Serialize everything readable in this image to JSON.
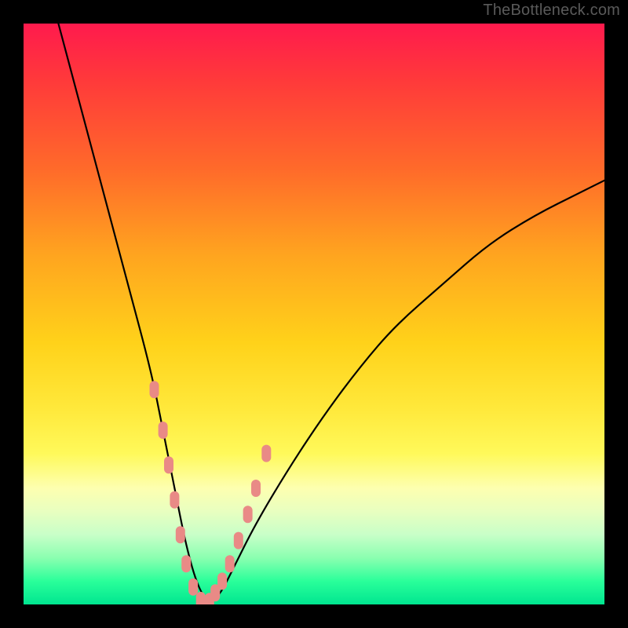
{
  "watermark": "TheBottleneck.com",
  "chart_data": {
    "type": "line",
    "title": "",
    "xlabel": "",
    "ylabel": "",
    "xlim": [
      0,
      100
    ],
    "ylim": [
      0,
      100
    ],
    "series": [
      {
        "name": "bottleneck-curve",
        "x": [
          6,
          10,
          14,
          18,
          22,
          24,
          26,
          28,
          30,
          32,
          34,
          36,
          40,
          46,
          52,
          58,
          64,
          72,
          80,
          88,
          96,
          100
        ],
        "values": [
          100,
          85,
          70,
          55,
          40,
          30,
          20,
          10,
          3,
          0,
          2,
          6,
          14,
          24,
          33,
          41,
          48,
          55,
          62,
          67,
          71,
          73
        ]
      }
    ],
    "markers": {
      "name": "highlighted-range",
      "color": "#e98a86",
      "points_x": [
        22.5,
        24,
        25,
        26,
        27,
        28,
        29.2,
        30.5,
        32,
        33,
        34.2,
        35.5,
        37,
        38.6,
        40,
        41.8
      ],
      "points_y": [
        37,
        30,
        24,
        18,
        12,
        7,
        3,
        0.7,
        0.5,
        2,
        4,
        7,
        11,
        15.5,
        20,
        26
      ]
    },
    "legend": false,
    "grid": false
  }
}
